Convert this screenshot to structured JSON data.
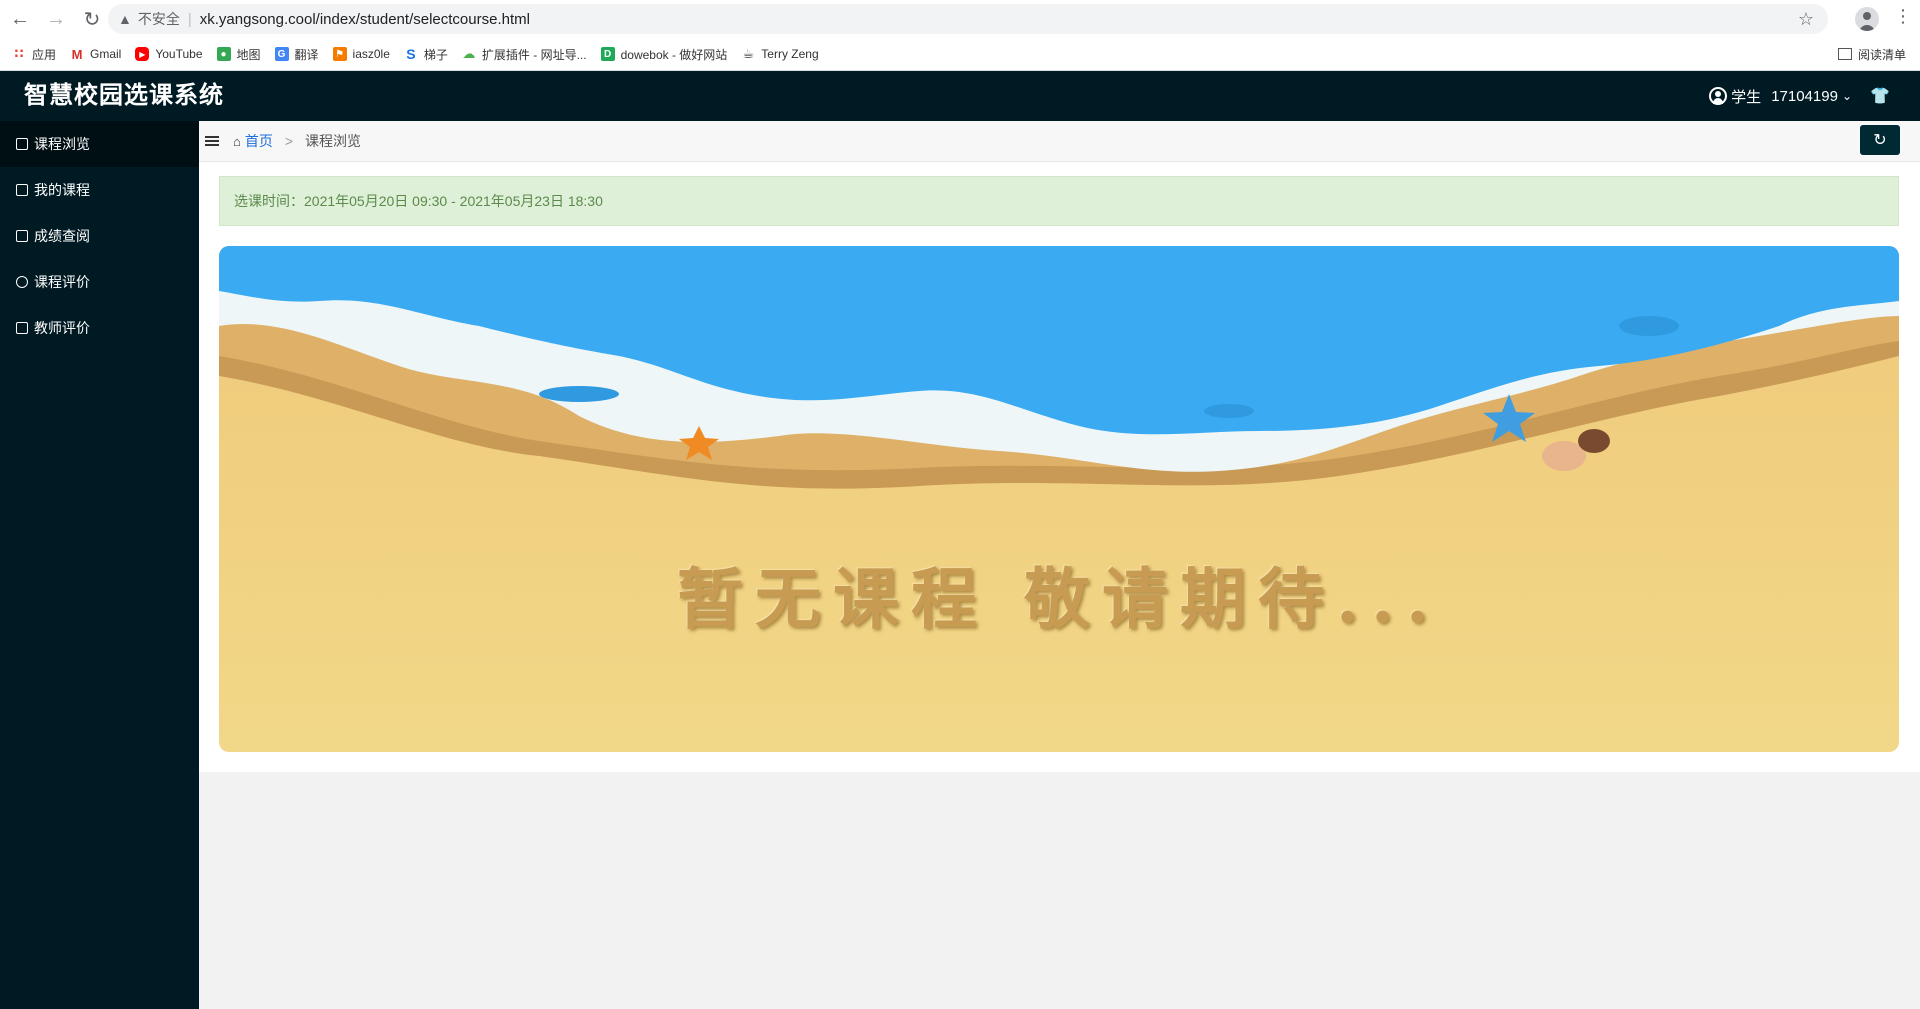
{
  "browser": {
    "security_label": "不安全",
    "url": "xk.yangsong.cool/index/student/selectcourse.html",
    "bookmarks": [
      {
        "label": "应用",
        "icon": "apps-grid-icon",
        "color": "#e94235"
      },
      {
        "label": "Gmail",
        "icon": "gmail-icon",
        "color": "#d93025"
      },
      {
        "label": "YouTube",
        "icon": "youtube-icon",
        "color": "#ff0000"
      },
      {
        "label": "地图",
        "icon": "maps-icon",
        "color": "#34a853"
      },
      {
        "label": "翻译",
        "icon": "translate-icon",
        "color": "#4285f4"
      },
      {
        "label": "iasz0le",
        "icon": "flag-icon",
        "color": "#f57c00"
      },
      {
        "label": "梯子",
        "icon": "s-logo-icon",
        "color": "#1a73e8"
      },
      {
        "label": "扩展插件 - 网址导...",
        "icon": "extension-icon",
        "color": "#4caf50"
      },
      {
        "label": "dowebok - 做好网站",
        "icon": "d-logo-icon",
        "color": "#1faa59"
      },
      {
        "label": "Terry Zeng",
        "icon": "cup-icon",
        "color": "#333333"
      }
    ],
    "reading_list_label": "阅读清单"
  },
  "header": {
    "title": "智慧校园选课系统",
    "user_role": "学生",
    "user_id": "17104199"
  },
  "sidebar": {
    "items": [
      {
        "label": "课程浏览",
        "icon": "document-icon",
        "active": true
      },
      {
        "label": "我的课程",
        "icon": "card-icon",
        "active": false
      },
      {
        "label": "成绩查阅",
        "icon": "list-icon",
        "active": false
      },
      {
        "label": "课程评价",
        "icon": "target-icon",
        "active": false
      },
      {
        "label": "教师评价",
        "icon": "teacher-icon",
        "active": false
      }
    ]
  },
  "breadcrumb": {
    "home": "首页",
    "separator": ">",
    "current": "课程浏览"
  },
  "main": {
    "selection_time": "选课时间：2021年05月20日 09:30 - 2021年05月23日 18:30",
    "banner_text": "暂无课程  敬请期待..."
  },
  "colors": {
    "sidebar_bg": "#001a23",
    "alert_bg": "#dff0d8",
    "link": "#1e6fd9"
  }
}
